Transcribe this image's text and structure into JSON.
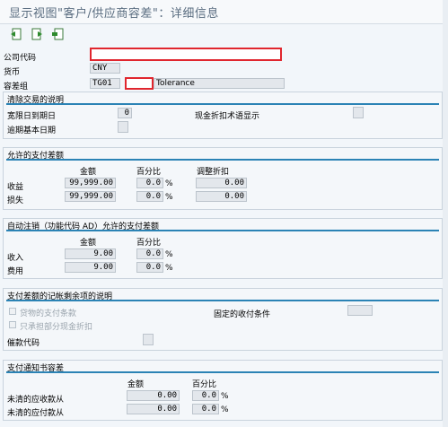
{
  "title": "显示视图\"客户/供应商容差\"：详细信息",
  "toolbar": {
    "icons": [
      "prev-entry-icon",
      "next-entry-icon",
      "select-icon"
    ]
  },
  "header": {
    "company_code_label": "公司代码",
    "company_code_value": "",
    "currency_label": "货币",
    "currency_value": "CNY",
    "tolerance_group_label": "容差组",
    "tolerance_group_value": "TG01",
    "tolerance_code_value": "",
    "tolerance_desc": "Tolerance"
  },
  "clearing": {
    "section_title": "清除交易的说明",
    "grace_days_label": "宽限日到期日",
    "grace_days_value": "0",
    "cash_disc_terms_label": "现金折扣术语显示",
    "arrears_base_label": "逾期基本日期"
  },
  "permitted": {
    "section_title": "允许的支付差额",
    "col_amount": "金额",
    "col_percent": "百分比",
    "col_adjust": "调整折扣",
    "rows": [
      {
        "label": "收益",
        "amount": "99,999.00",
        "percent": "0.0",
        "adjust": "0.00"
      },
      {
        "label": "损失",
        "amount": "99,999.00",
        "percent": "0.0",
        "adjust": "0.00"
      }
    ]
  },
  "auto_writeoff": {
    "section_title": "自动注销（功能代码 AD）允许的支付差额",
    "col_amount": "金额",
    "col_percent": "百分比",
    "rows": [
      {
        "label": "收入",
        "amount": "9.00",
        "percent": "0.0"
      },
      {
        "label": "费用",
        "amount": "9.00",
        "percent": "0.0"
      }
    ]
  },
  "residual": {
    "section_title": "支付差额的记帐剩余项的说明",
    "opt1": "贷物的支付条款",
    "opt2": "只承担部分现金折扣",
    "fixed_terms_label": "固定的收付条件",
    "dunning_key_label": "催款代码"
  },
  "notice": {
    "section_title": "支付通知书容差",
    "col_amount": "金额",
    "col_percent": "百分比",
    "rows": [
      {
        "label": "未清的应收款从",
        "amount": "0.00",
        "percent": "0.0"
      },
      {
        "label": "未清的应付款从",
        "amount": "0.00",
        "percent": "0.0"
      }
    ]
  },
  "percent_sign": "%"
}
